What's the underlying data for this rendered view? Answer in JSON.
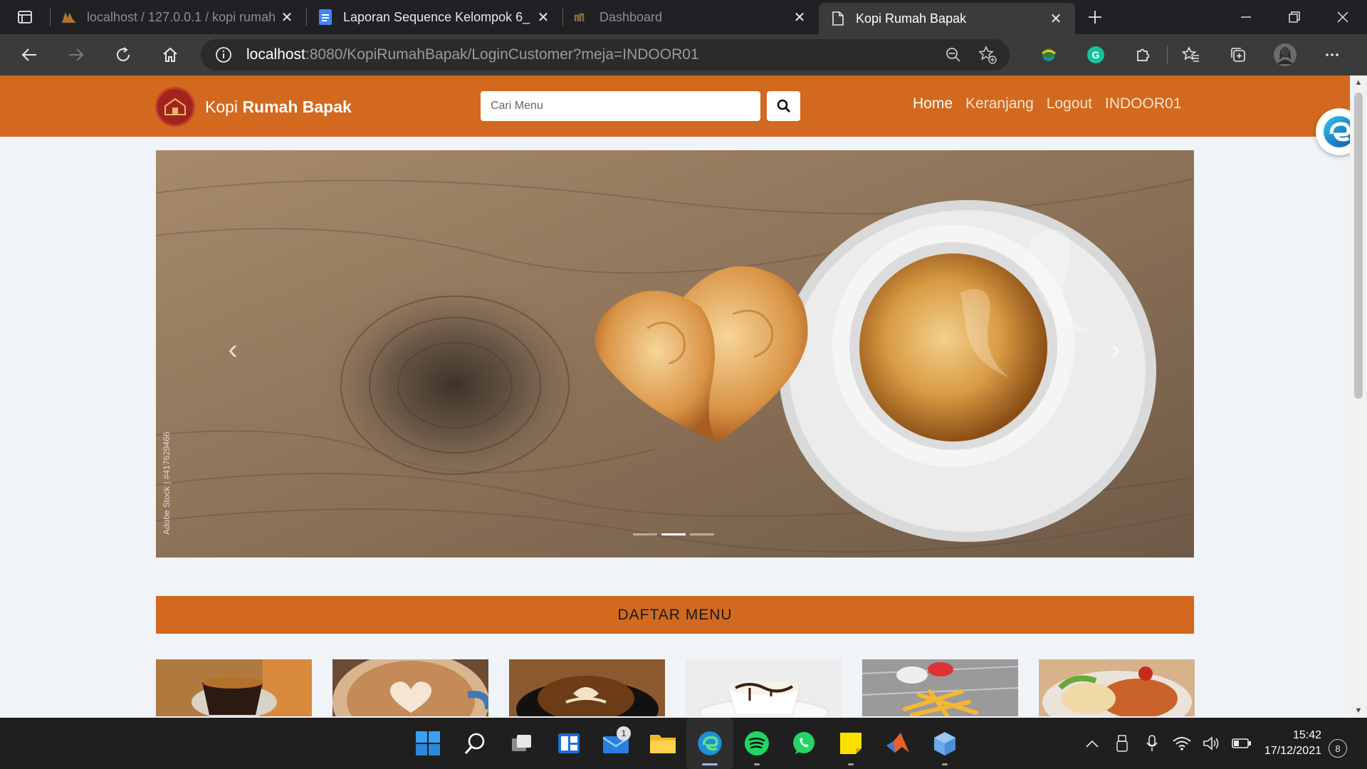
{
  "browser": {
    "tabs": [
      {
        "title": "localhost / 127.0.0.1 / kopi rumah",
        "icon": "phpmyadmin-icon",
        "active": false
      },
      {
        "title": "Laporan Sequence Kelompok 6_",
        "icon": "google-docs-icon",
        "active": false
      },
      {
        "title": "Dashboard",
        "icon": "dashboard-icon",
        "active": false
      },
      {
        "title": "Kopi Rumah Bapak",
        "icon": "page-icon",
        "active": true
      }
    ],
    "url_host": "localhost",
    "url_rest": ":8080/KopiRumahBapak/LoginCustomer?meja=INDOOR01"
  },
  "site": {
    "brand_light": "Kopi ",
    "brand_bold": "Rumah Bapak",
    "search_placeholder": "Cari Menu",
    "nav": [
      {
        "label": "Home",
        "active": true
      },
      {
        "label": "Keranjang",
        "active": false
      },
      {
        "label": "Logout",
        "active": false
      },
      {
        "label": "INDOOR01",
        "active": false
      }
    ],
    "accent_color": "#d2691e"
  },
  "carousel": {
    "slide_count": 3,
    "active_slide": 2,
    "watermark": "Adobe Stock | #417629466"
  },
  "menu_section": {
    "title": "DAFTAR MENU",
    "items": [
      {
        "icon": "espresso-image"
      },
      {
        "icon": "latte-heart-image"
      },
      {
        "icon": "cappuccino-image"
      },
      {
        "icon": "chocolate-coffee-image"
      },
      {
        "icon": "french-fries-image"
      },
      {
        "icon": "fried-rice-image"
      }
    ]
  },
  "taskbar": {
    "mail_badge": "1",
    "time": "15:42",
    "date": "17/12/2021",
    "notifications": "8"
  }
}
